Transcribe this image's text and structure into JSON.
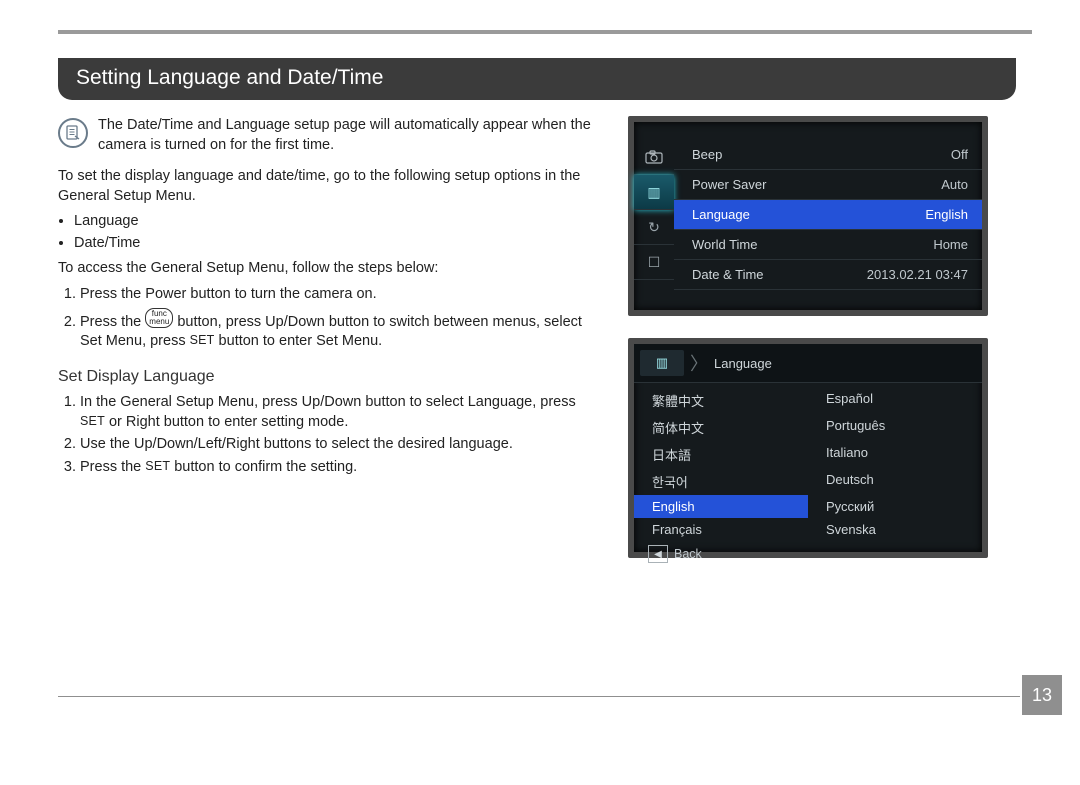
{
  "page_number": "13",
  "section_title": "Setting Language and Date/Time",
  "note_text": "The Date/Time and Language setup page will automatically appear when the camera is turned on for the first time.",
  "intro_text": "To set the display language and date/time, go to the following setup options in the General Setup Menu.",
  "bullets": [
    "Language",
    "Date/Time"
  ],
  "access_text": "To access the General Setup Menu, follow the steps below:",
  "steps_a": {
    "s1": "Press the Power button to turn the camera on.",
    "s2_pre": "Press the ",
    "s2_btn_top": "func",
    "s2_btn_bot": "menu",
    "s2_mid": " button, press Up/Down button to switch between menus, select Set Menu, press ",
    "s2_set": "SET",
    "s2_post": " button to enter Set Menu."
  },
  "subhead": "Set Display Language",
  "steps_b": {
    "s1_pre": "In the General Setup Menu, press Up/Down button to select Language, press ",
    "s1_set": "SET",
    "s1_post": " or Right button to enter setting mode.",
    "s2": "Use the Up/Down/Left/Right buttons to select the desired language.",
    "s3_pre": "Press the ",
    "s3_set": "SET",
    "s3_post": " button to confirm the setting."
  },
  "shot1": {
    "rows": [
      {
        "label": "Beep",
        "value": "Off"
      },
      {
        "label": "Power Saver",
        "value": "Auto"
      },
      {
        "label": "Language",
        "value": "English",
        "selected": true
      },
      {
        "label": "World Time",
        "value": "Home"
      },
      {
        "label": "Date & Time",
        "value": "2013.02.21 03:47"
      }
    ]
  },
  "shot2": {
    "title": "Language",
    "langs_left": [
      "繁體中文",
      "简体中文",
      "日本語",
      "한국어",
      "English",
      "Français"
    ],
    "langs_right": [
      "Español",
      "Português",
      "Italiano",
      "Deutsch",
      "Русский",
      "Svenska"
    ],
    "selected": "English",
    "back": "Back"
  }
}
